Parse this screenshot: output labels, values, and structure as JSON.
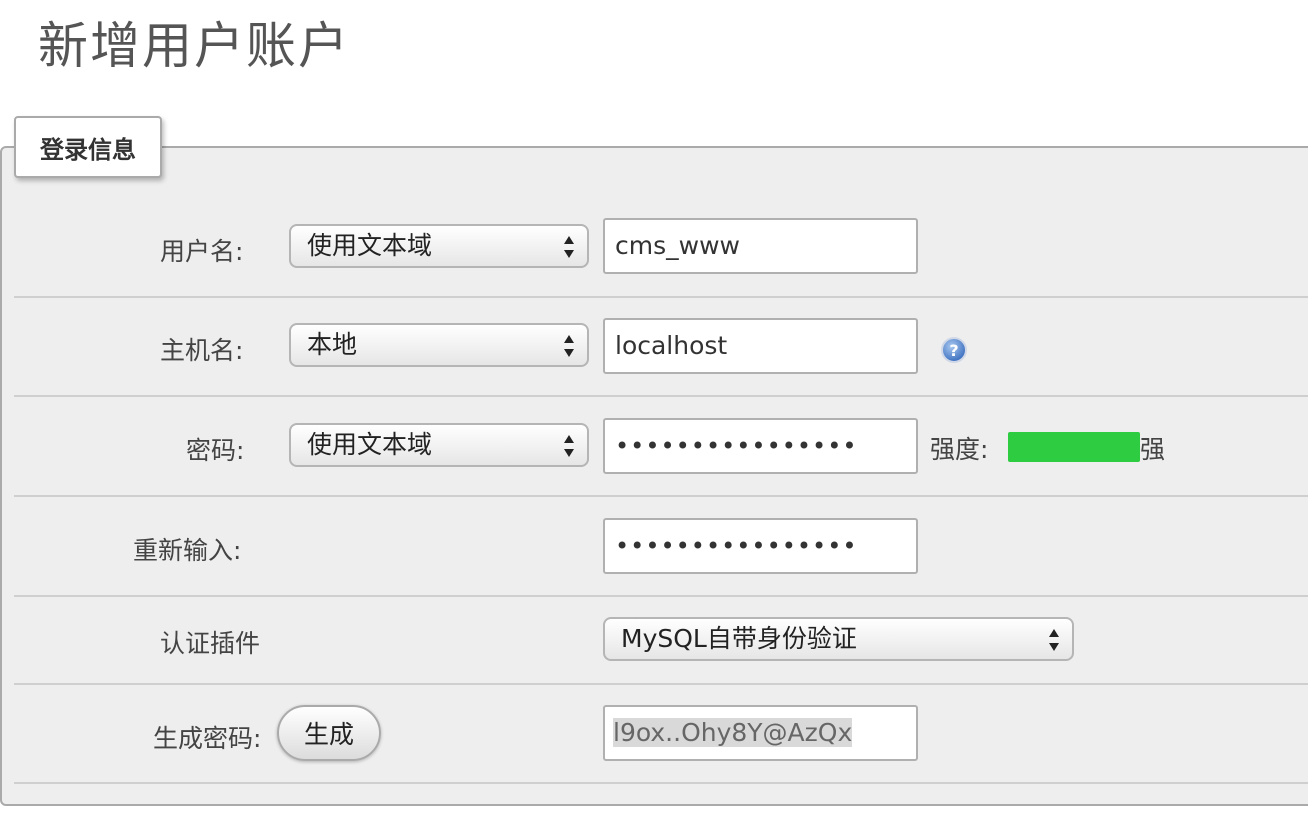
{
  "page": {
    "title": "新增用户账户"
  },
  "legend": {
    "label": "登录信息"
  },
  "username": {
    "label": "用户名:",
    "select_value": "使用文本域",
    "input_value": "cms_www"
  },
  "hostname": {
    "label": "主机名:",
    "select_value": "本地",
    "input_value": "localhost",
    "help_icon": "help-icon"
  },
  "password": {
    "label": "密码:",
    "select_value": "使用文本域",
    "input_value": "••••••••••••••••",
    "strength_label": "强度:",
    "strength_level": 1.0,
    "strength_color": "#2ecc40",
    "strength_text": "强"
  },
  "reenter": {
    "label": "重新输入:",
    "input_value": "••••••••••••••••"
  },
  "auth_plugin": {
    "label": "认证插件",
    "select_value": "MySQL自带身份验证"
  },
  "generate": {
    "label": "生成密码:",
    "button_label": "生成",
    "value": "l9ox..Ohy8Y@AzQx"
  }
}
